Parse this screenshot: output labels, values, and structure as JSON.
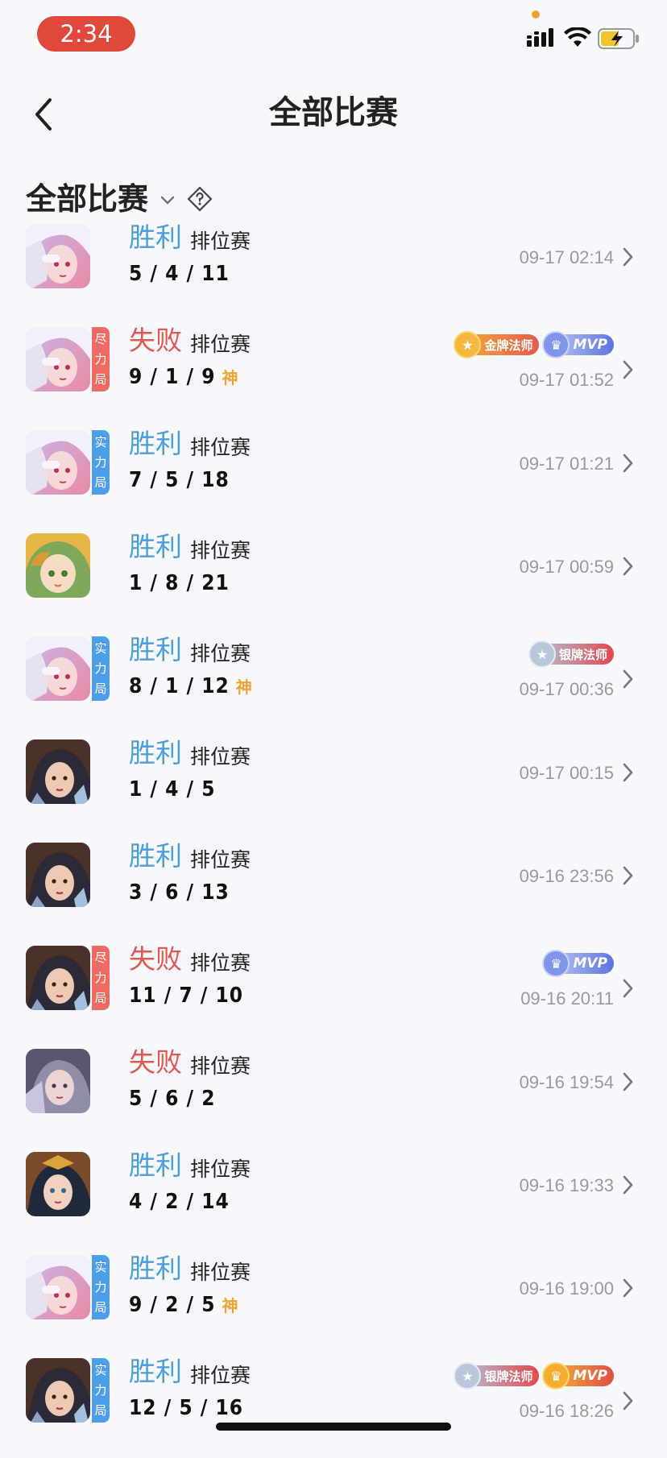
{
  "status_bar": {
    "time": "2:34"
  },
  "nav": {
    "title": "全部比赛"
  },
  "filter": {
    "label": "全部比赛"
  },
  "colors": {
    "win": "#4a9fd8",
    "loss": "#e05a52",
    "tag_red": "#ee6a62",
    "tag_blue": "#4d9ee8",
    "god": "#f0a332"
  },
  "matches": [
    {
      "hero": "hero-a",
      "tag": null,
      "result": "胜利",
      "outcome": "win",
      "mode": "排位赛",
      "kda": "5 / 4 / 11",
      "god": null,
      "time": "09-17 02:14",
      "badges": []
    },
    {
      "hero": "hero-a",
      "tag": {
        "text": [
          "尽",
          "力",
          "局"
        ],
        "color": "red"
      },
      "result": "失败",
      "outcome": "loss",
      "mode": "排位赛",
      "kda": "9 / 1 / 9",
      "god": "神",
      "time": "09-17 01:52",
      "badges": [
        {
          "type": "gold",
          "label": "金牌法师"
        },
        {
          "type": "mvp-blue",
          "label": "MVP"
        }
      ]
    },
    {
      "hero": "hero-a",
      "tag": {
        "text": [
          "实",
          "力",
          "局"
        ],
        "color": "blue"
      },
      "result": "胜利",
      "outcome": "win",
      "mode": "排位赛",
      "kda": "7 / 5 / 18",
      "god": null,
      "time": "09-17 01:21",
      "badges": []
    },
    {
      "hero": "hero-b",
      "tag": null,
      "result": "胜利",
      "outcome": "win",
      "mode": "排位赛",
      "kda": "1 / 8 / 21",
      "god": null,
      "time": "09-17 00:59",
      "badges": []
    },
    {
      "hero": "hero-a",
      "tag": {
        "text": [
          "实",
          "力",
          "局"
        ],
        "color": "blue"
      },
      "result": "胜利",
      "outcome": "win",
      "mode": "排位赛",
      "kda": "8 / 1 / 12",
      "god": "神",
      "time": "09-17 00:36",
      "badges": [
        {
          "type": "silver",
          "label": "银牌法师"
        }
      ]
    },
    {
      "hero": "hero-c",
      "tag": null,
      "result": "胜利",
      "outcome": "win",
      "mode": "排位赛",
      "kda": "1 / 4 / 5",
      "god": null,
      "time": "09-17 00:15",
      "badges": []
    },
    {
      "hero": "hero-c",
      "tag": null,
      "result": "胜利",
      "outcome": "win",
      "mode": "排位赛",
      "kda": "3 / 6 / 13",
      "god": null,
      "time": "09-16 23:56",
      "badges": []
    },
    {
      "hero": "hero-c",
      "tag": {
        "text": [
          "尽",
          "力",
          "局"
        ],
        "color": "red"
      },
      "result": "失败",
      "outcome": "loss",
      "mode": "排位赛",
      "kda": "11 / 7 / 10",
      "god": null,
      "time": "09-16 20:11",
      "badges": [
        {
          "type": "mvp-blue",
          "label": "MVP"
        }
      ]
    },
    {
      "hero": "hero-d",
      "tag": null,
      "result": "失败",
      "outcome": "loss",
      "mode": "排位赛",
      "kda": "5 / 6 / 2",
      "god": null,
      "time": "09-16 19:54",
      "badges": []
    },
    {
      "hero": "hero-e",
      "tag": null,
      "result": "胜利",
      "outcome": "win",
      "mode": "排位赛",
      "kda": "4 / 2 / 14",
      "god": null,
      "time": "09-16 19:33",
      "badges": []
    },
    {
      "hero": "hero-a",
      "tag": {
        "text": [
          "实",
          "力",
          "局"
        ],
        "color": "blue"
      },
      "result": "胜利",
      "outcome": "win",
      "mode": "排位赛",
      "kda": "9 / 2 / 5",
      "god": "神",
      "time": "09-16 19:00",
      "badges": []
    },
    {
      "hero": "hero-c",
      "tag": {
        "text": [
          "实",
          "力",
          "局"
        ],
        "color": "blue"
      },
      "result": "胜利",
      "outcome": "win",
      "mode": "排位赛",
      "kda": "12 / 5 / 16",
      "god": null,
      "time": "09-16 18:26",
      "badges": [
        {
          "type": "silver",
          "label": "银牌法师"
        },
        {
          "type": "mvp-gold",
          "label": "MVP"
        }
      ]
    }
  ]
}
